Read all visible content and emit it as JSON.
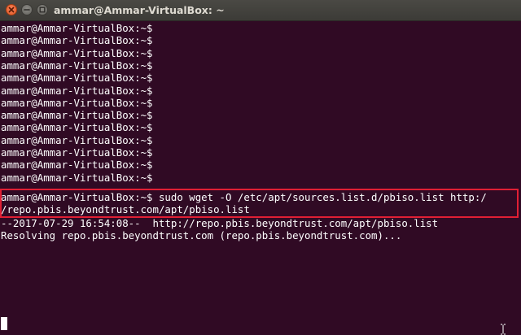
{
  "window": {
    "title": "ammar@Ammar-VirtualBox: ~"
  },
  "terminal": {
    "prompt_lines": [
      "ammar@Ammar-VirtualBox:~$",
      "ammar@Ammar-VirtualBox:~$",
      "ammar@Ammar-VirtualBox:~$",
      "ammar@Ammar-VirtualBox:~$",
      "ammar@Ammar-VirtualBox:~$",
      "ammar@Ammar-VirtualBox:~$",
      "ammar@Ammar-VirtualBox:~$",
      "ammar@Ammar-VirtualBox:~$",
      "ammar@Ammar-VirtualBox:~$",
      "ammar@Ammar-VirtualBox:~$",
      "ammar@Ammar-VirtualBox:~$",
      "ammar@Ammar-VirtualBox:~$",
      "ammar@Ammar-VirtualBox:~$"
    ],
    "command_line_1": "ammar@Ammar-VirtualBox:~$ sudo wget -O /etc/apt/sources.list.d/pbiso.list http:/",
    "command_line_2": "/repo.pbis.beyondtrust.com/apt/pbiso.list",
    "output_line_1": "--2017-07-29 16:54:08--  http://repo.pbis.beyondtrust.com/apt/pbiso.list",
    "output_line_2": "Resolving repo.pbis.beyondtrust.com (repo.pbis.beyondtrust.com)..."
  },
  "colors": {
    "terminal_bg": "#300a24",
    "terminal_fg": "#ffffff",
    "highlight": "#e01f34",
    "close_button": "#e45a26"
  },
  "icons": {
    "close": "close-icon",
    "minimize": "minimize-icon",
    "maximize": "maximize-icon",
    "mouse": "text-cursor-icon"
  }
}
